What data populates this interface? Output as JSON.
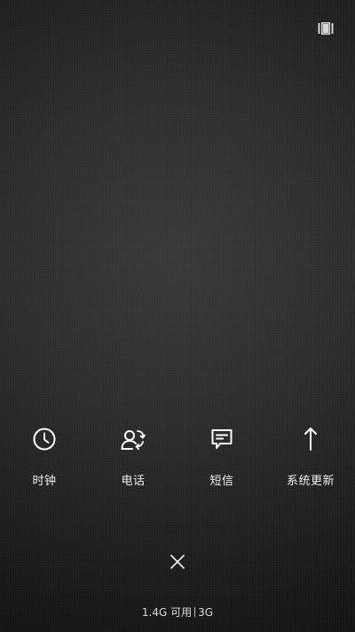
{
  "recents_button": {
    "icon": "multitask-icon"
  },
  "apps": [
    {
      "label": "时钟",
      "icon": "clock-icon"
    },
    {
      "label": "电话",
      "icon": "phone-icon"
    },
    {
      "label": "短信",
      "icon": "message-icon"
    },
    {
      "label": "系统更新",
      "icon": "arrow-up-icon"
    }
  ],
  "close_button": {
    "icon": "close-icon"
  },
  "memory": {
    "available": "1.4G 可用",
    "total": "3G"
  },
  "colors": {
    "icon": "#ffffff",
    "label": "#f0f0f0",
    "background_center": "#3a3a3a",
    "background_edge": "#0d0d0d"
  }
}
